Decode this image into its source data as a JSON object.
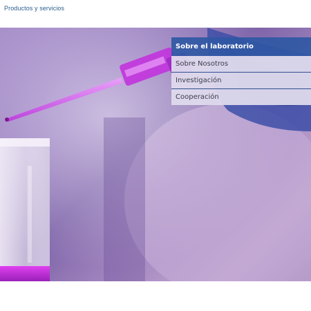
{
  "breadcrumb": {
    "label": "Productos y servicios"
  },
  "hero": {
    "alt": "Pipeta con líquido morado sobre un frasco de laboratorio"
  },
  "side_menu": {
    "title": "Sobre el laboratorio",
    "items": [
      {
        "label": "Sobre Nosotros"
      },
      {
        "label": "Investigación"
      },
      {
        "label": "Cooperación"
      }
    ]
  },
  "colors": {
    "link": "#2c5d8e",
    "menu_title_bg": "#3058a4",
    "menu_item_bg": "#dedaec",
    "liquid": "#d040e0"
  }
}
